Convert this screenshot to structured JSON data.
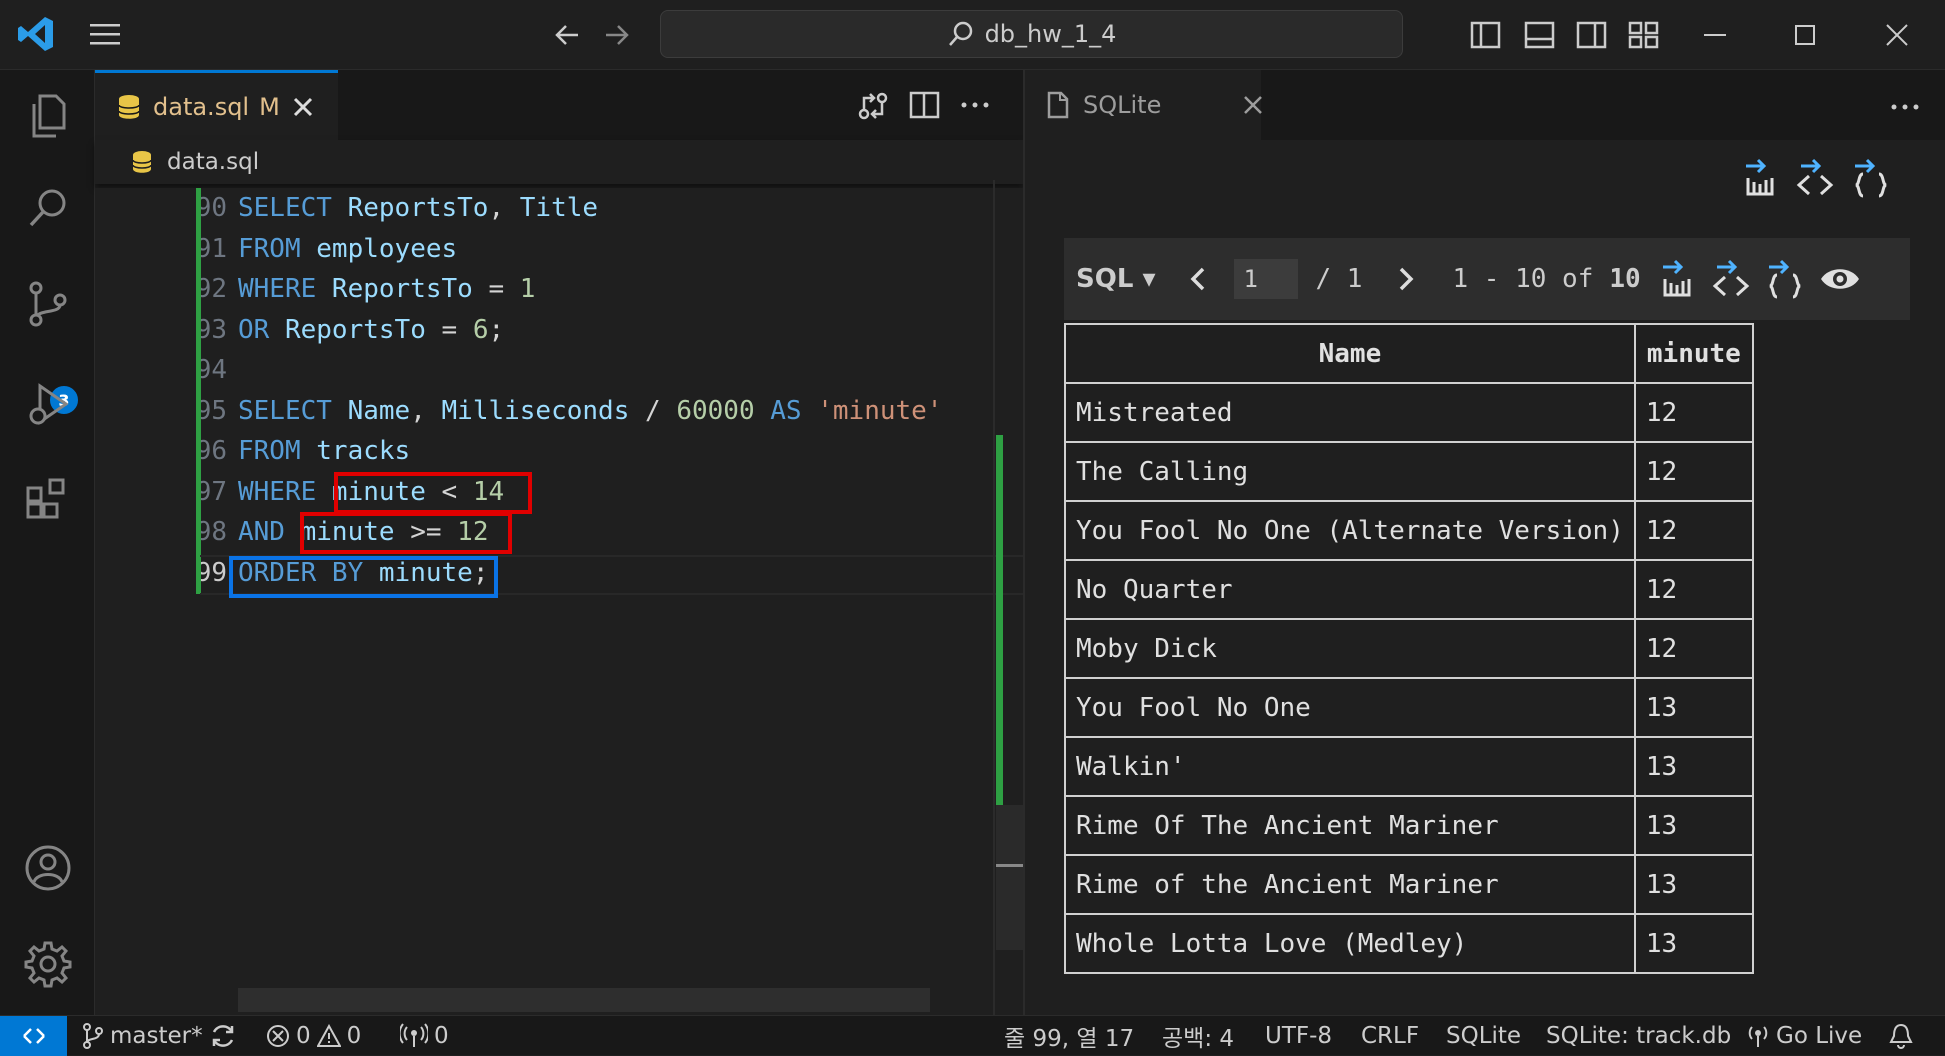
{
  "titlebar": {
    "search_text": "db_hw_1_4"
  },
  "activity": {
    "source_control_badge": "3"
  },
  "editor": {
    "tab_label": "data.sql",
    "tab_modified": "M",
    "breadcrumb": "data.sql",
    "lines": [
      {
        "num": "90",
        "tokens": [
          [
            "kw",
            "SELECT "
          ],
          [
            "id",
            "ReportsTo"
          ],
          [
            "op",
            ", "
          ],
          [
            "id",
            "Title"
          ]
        ]
      },
      {
        "num": "91",
        "tokens": [
          [
            "kw",
            "FROM "
          ],
          [
            "id",
            "employees"
          ]
        ]
      },
      {
        "num": "92",
        "tokens": [
          [
            "kw",
            "WHERE "
          ],
          [
            "id",
            "ReportsTo"
          ],
          [
            "op",
            " = "
          ],
          [
            "nm",
            "1"
          ]
        ]
      },
      {
        "num": "93",
        "tokens": [
          [
            "kw",
            "OR "
          ],
          [
            "id",
            "ReportsTo"
          ],
          [
            "op",
            " = "
          ],
          [
            "nm",
            "6"
          ],
          [
            "op",
            ";"
          ]
        ]
      },
      {
        "num": "94",
        "tokens": []
      },
      {
        "num": "95",
        "tokens": [
          [
            "kw",
            "SELECT "
          ],
          [
            "id",
            "Name"
          ],
          [
            "op",
            ", "
          ],
          [
            "id",
            "Milliseconds"
          ],
          [
            "op",
            " / "
          ],
          [
            "nm",
            "60000"
          ],
          [
            "kw",
            " AS "
          ],
          [
            "st",
            "'minute'"
          ]
        ]
      },
      {
        "num": "96",
        "tokens": [
          [
            "kw",
            "FROM "
          ],
          [
            "id",
            "tracks"
          ]
        ]
      },
      {
        "num": "97",
        "tokens": [
          [
            "kw",
            "WHERE "
          ],
          [
            "id",
            "minute"
          ],
          [
            "op",
            " < "
          ],
          [
            "nm",
            "14"
          ]
        ]
      },
      {
        "num": "98",
        "tokens": [
          [
            "kw",
            "AND "
          ],
          [
            "id",
            "minute"
          ],
          [
            "op",
            " >= "
          ],
          [
            "nm",
            "12"
          ]
        ]
      },
      {
        "num": "99",
        "tokens": [
          [
            "kw",
            "ORDER BY "
          ],
          [
            "id",
            "minute"
          ],
          [
            "op",
            ";"
          ]
        ]
      }
    ]
  },
  "sqlite_panel": {
    "tab_label": "SQLite",
    "format_label": "SQL ▾",
    "page_value": "1",
    "page_total": "/ 1",
    "range_text": "1 - 10 of",
    "total_rows": "10",
    "columns": [
      "Name",
      "minute"
    ],
    "rows": [
      [
        "Mistreated",
        "12"
      ],
      [
        "The Calling",
        "12"
      ],
      [
        "You Fool No One (Alternate Version)",
        "12"
      ],
      [
        "No Quarter",
        "12"
      ],
      [
        "Moby Dick",
        "12"
      ],
      [
        "You Fool No One",
        "13"
      ],
      [
        "Walkin'",
        "13"
      ],
      [
        "Rime Of The Ancient Mariner",
        "13"
      ],
      [
        "Rime of the Ancient Mariner",
        "13"
      ],
      [
        "Whole Lotta Love (Medley)",
        "13"
      ]
    ]
  },
  "statusbar": {
    "branch": "master*",
    "errors": "0",
    "warnings": "0",
    "ports": "0",
    "position": "줄 99, 열 17",
    "spaces": "공백: 4",
    "encoding": "UTF-8",
    "eol": "CRLF",
    "language": "SQLite",
    "db": "SQLite: track.db",
    "golive": "Go Live"
  }
}
